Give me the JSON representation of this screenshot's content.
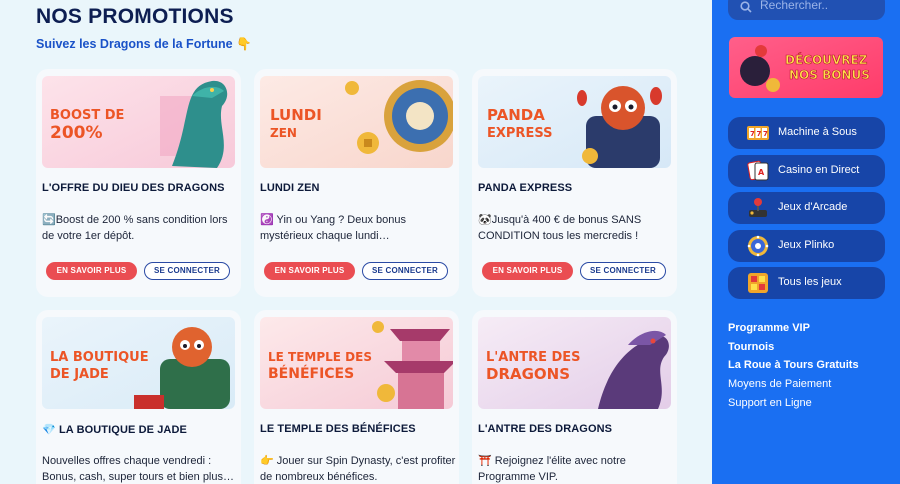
{
  "header": {
    "title": "NOS PROMOTIONS",
    "subtitle": "Suivez les Dragons de la Fortune 👇"
  },
  "cards": [
    {
      "banner_line1": "BOOST DE",
      "banner_line2": "200%",
      "title": "L'OFFRE DU DIEU DES DRAGONS",
      "desc": "🔄Boost de 200 % sans condition lors de votre 1er dépôt.",
      "more": "EN SAVOIR PLUS",
      "login": "SE CONNECTER"
    },
    {
      "banner_line1": "LUNDI",
      "banner_line2": "ZEN",
      "title": "LUNDI ZEN",
      "desc": "☯️ Yin ou Yang ? Deux bonus mystérieux chaque lundi…",
      "more": "EN SAVOIR PLUS",
      "login": "SE CONNECTER"
    },
    {
      "banner_line1": "PANDA",
      "banner_line2": "EXPRESS",
      "title": "PANDA EXPRESS",
      "desc": "🐼Jusqu'à 400 € de bonus SANS CONDITION tous les mercredis !",
      "more": "EN SAVOIR PLUS",
      "login": "SE CONNECTER"
    },
    {
      "banner_line1": "LA BOUTIQUE",
      "banner_line2": "DE JADE",
      "title": "💎 LA BOUTIQUE DE JADE",
      "desc": "Nouvelles offres chaque vendredi : Bonus, cash, super tours et bien plus…"
    },
    {
      "banner_line1": "LE TEMPLE DES",
      "banner_line2": "BÉNÉFICES",
      "title": "LE TEMPLE DES BÉNÉFICES",
      "desc": "👉 Jouer sur Spin Dynasty, c'est profiter de nombreux bénéfices."
    },
    {
      "banner_line1": "L'ANTRE DES",
      "banner_line2": "DRAGONS",
      "title": "L'ANTRE DES DRAGONS",
      "desc": "⛩️ Rejoignez l'élite avec notre Programme VIP."
    }
  ],
  "sidebar": {
    "search_placeholder": "Rechercher..",
    "promo_line1": "DÉCOUVREZ",
    "promo_line2": "NOS BONUS",
    "categories": [
      {
        "label": "Machine à Sous",
        "icon": "slot-machine-icon"
      },
      {
        "label": "Casino en Direct",
        "icon": "playing-cards-icon"
      },
      {
        "label": "Jeux d'Arcade",
        "icon": "joystick-icon"
      },
      {
        "label": "Jeux Plinko",
        "icon": "plinko-wheel-icon"
      },
      {
        "label": "Tous les jeux",
        "icon": "grid-icon"
      }
    ],
    "links": [
      {
        "label": "Programme VIP",
        "bold": true
      },
      {
        "label": "Tournois",
        "bold": true
      },
      {
        "label": "La Roue à Tours Gratuits",
        "bold": true
      },
      {
        "label": "Moyens de Paiement",
        "bold": false
      },
      {
        "label": "Support en Ligne",
        "bold": false
      }
    ]
  },
  "colors": {
    "accent_red": "#ea4d52",
    "sidebar_blue": "#1a6ff2",
    "title_navy": "#0d1e52",
    "banner_orange": "#ec5526"
  }
}
